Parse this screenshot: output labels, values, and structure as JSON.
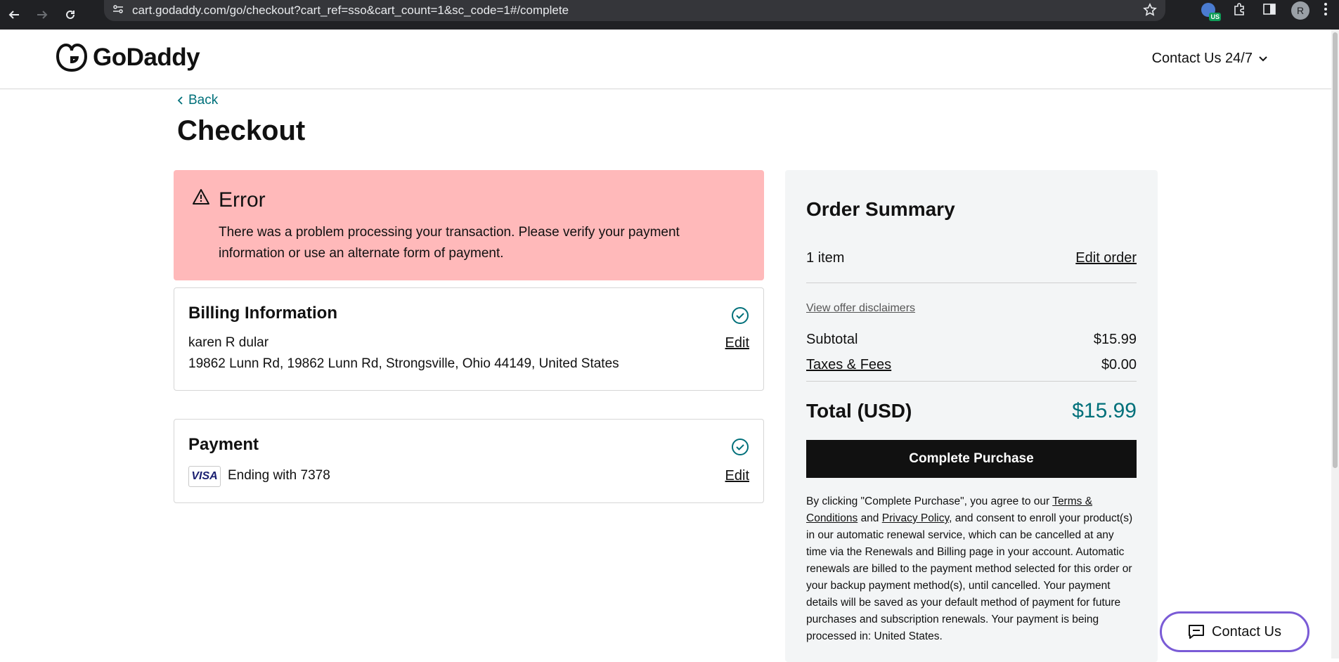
{
  "browser": {
    "url": "cart.godaddy.com/go/checkout?cart_ref=sso&cart_count=1&sc_code=1#/complete",
    "vpn_badge": "US",
    "profile_initial": "R"
  },
  "header": {
    "logo_text": "GoDaddy",
    "contact_label": "Contact Us 24/7"
  },
  "page": {
    "back_label": "Back",
    "title": "Checkout"
  },
  "error": {
    "title": "Error",
    "message": "There was a problem processing your transaction. Please verify your payment information or use an alternate form of payment."
  },
  "billing": {
    "title": "Billing Information",
    "name": "karen R dular",
    "address": "19862 Lunn Rd, 19862 Lunn Rd, Strongsville, Ohio 44149, United States",
    "edit_label": "Edit"
  },
  "payment": {
    "title": "Payment",
    "card_brand": "VISA",
    "card_text": "Ending with 7378",
    "edit_label": "Edit"
  },
  "summary": {
    "title": "Order Summary",
    "items": "1 item",
    "edit_order_label": "Edit order",
    "disclaimers_label": "View offer disclaimers",
    "subtotal_label": "Subtotal",
    "subtotal_value": "$15.99",
    "taxes_label": "Taxes & Fees",
    "taxes_value": "$0.00",
    "total_label": "Total (USD)",
    "total_value": "$15.99",
    "complete_label": "Complete Purchase",
    "legal_1": "By clicking \"Complete Purchase\", you agree to our",
    "terms_label": "Terms & Conditions",
    "and_text": "and",
    "privacy_label": "Privacy Policy",
    "legal_2": ", and consent to enroll your product(s) in our automatic renewal service, which can be cancelled at any time via the Renewals and Billing page in your account. Automatic renewals are billed to the payment method selected for this order or your backup payment method(s), until cancelled. Your payment details will be saved as your default method of payment for future purchases and subscription renewals. Your payment is being processed in: United States."
  },
  "chat": {
    "label": "Contact Us"
  },
  "colors": {
    "accent_teal": "#00707a",
    "error_bg": "#ffb9ba",
    "summary_bg": "#f3f5f6",
    "button_black": "#111111",
    "chat_border": "#7a5bd6"
  }
}
